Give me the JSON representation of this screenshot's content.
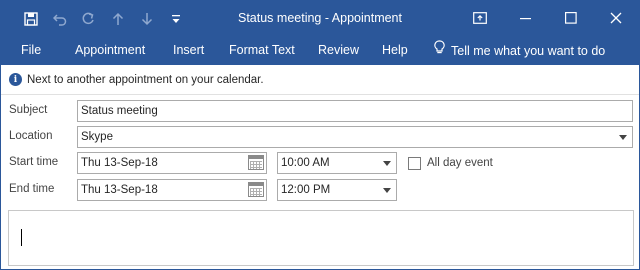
{
  "titlebar": {
    "title": "Status meeting  -  Appointment",
    "qat": {
      "save_icon": "save-icon",
      "undo_icon": "undo-icon",
      "redo_icon": "redo-icon",
      "up_icon": "up-arrow-icon",
      "down_icon": "down-arrow-icon",
      "customize_icon": "customize-qat-icon"
    },
    "controls": [
      "ribbon-display-options-icon",
      "minimize-icon",
      "maximize-icon",
      "close-icon"
    ]
  },
  "ribbon": {
    "tabs": [
      {
        "label": "File"
      },
      {
        "label": "Appointment"
      },
      {
        "label": "Insert"
      },
      {
        "label": "Format Text"
      },
      {
        "label": "Review"
      },
      {
        "label": "Help"
      }
    ],
    "tell_me": "Tell me what you want to do"
  },
  "infobar": {
    "message": "Next to another appointment on your calendar."
  },
  "form": {
    "subject_label": "Subject",
    "subject_value": "Status meeting",
    "location_label": "Location",
    "location_value": "Skype",
    "start_label": "Start time",
    "start_date": "Thu 13-Sep-18",
    "start_time": "10:00 AM",
    "end_label": "End time",
    "end_date": "Thu 13-Sep-18",
    "end_time": "12:00 PM",
    "all_day_label": "All day event",
    "all_day_checked": false
  },
  "colors": {
    "accent": "#2b579a"
  }
}
